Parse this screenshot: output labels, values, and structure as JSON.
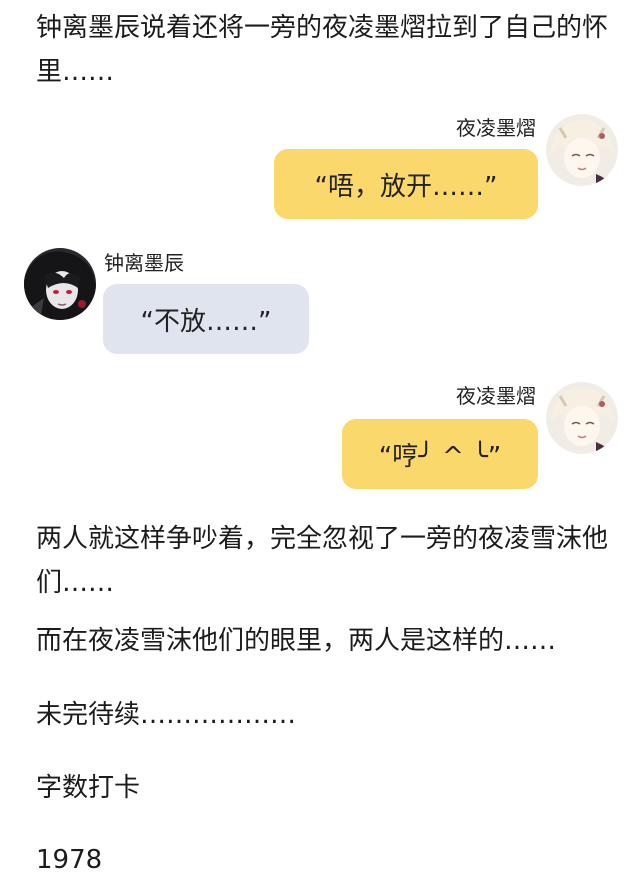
{
  "story": {
    "intro": "钟离墨辰说着还将一旁的夜凌墨熠拉到了自己的怀里……",
    "after_chat": "两人就这样争吵着，完全忽视了一旁的夜凌雪沫他们……",
    "view": "而在夜凌雪沫他们的眼里，两人是这样的……",
    "tbc": "未完待续………………",
    "word_count_label": "字数打卡",
    "word_count": "1978"
  },
  "chat": [
    {
      "speaker": "夜凌墨熠",
      "side": "right",
      "text": "“唔，放开……”",
      "avatar_icon": "avatar-light-hair-icon"
    },
    {
      "speaker": "钟离墨辰",
      "side": "left",
      "text": "“不放……”",
      "avatar_icon": "avatar-dark-hair-icon"
    },
    {
      "speaker": "夜凌墨熠",
      "side": "right",
      "text": "“哼╯ ^ ╰”",
      "avatar_icon": "avatar-light-hair-icon"
    }
  ],
  "colors": {
    "right_bubble": "#fbd86b",
    "left_bubble": "#dfe4ee",
    "background": "#ffffff"
  }
}
